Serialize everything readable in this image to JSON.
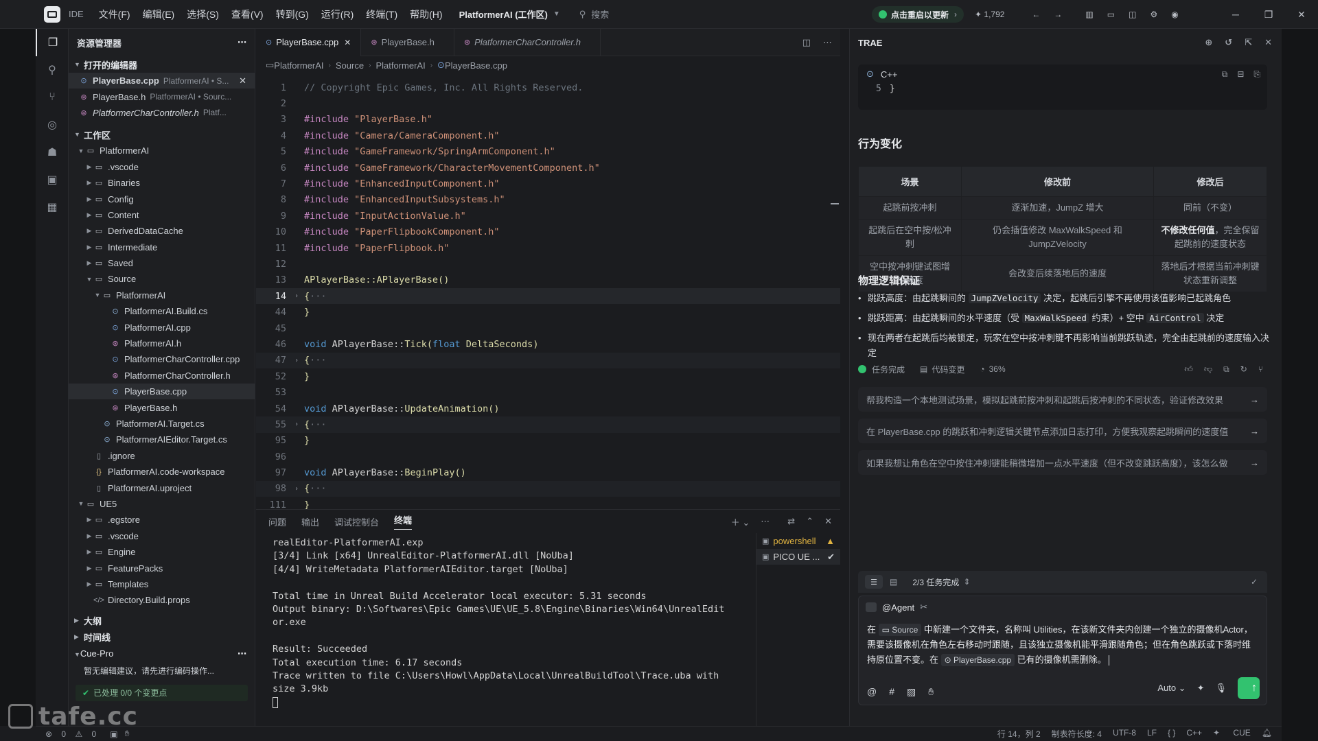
{
  "titlebar": {
    "ide_label": "IDE",
    "menus": [
      "文件(F)",
      "编辑(E)",
      "选择(S)",
      "查看(V)",
      "转到(G)",
      "运行(R)",
      "终端(T)",
      "帮助(H)"
    ],
    "workspace": "PlatformerAI (工作区)",
    "search_placeholder": "搜索",
    "update_label": "点击重启以更新",
    "count": "1,792"
  },
  "sidebar": {
    "title": "资源管理器",
    "open_editors_label": "打开的编辑器",
    "open_editors": [
      {
        "name": "PlayerBase.cpp",
        "path": "PlatformerAI • S...",
        "icon": "cpp-file-icon"
      },
      {
        "name": "PlayerBase.h",
        "path": "PlatformerAI • Sourc...",
        "icon": "h-file-icon"
      },
      {
        "name": "PlatformerCharController.h",
        "path": "Platf...",
        "icon": "h-file-icon"
      }
    ],
    "workspace_label": "工作区",
    "tree": [
      {
        "depth": 1,
        "type": "folder",
        "open": true,
        "name": "PlatformerAI"
      },
      {
        "depth": 2,
        "type": "folder",
        "open": false,
        "name": ".vscode"
      },
      {
        "depth": 2,
        "type": "folder",
        "open": false,
        "name": "Binaries"
      },
      {
        "depth": 2,
        "type": "folder",
        "open": false,
        "name": "Config"
      },
      {
        "depth": 2,
        "type": "folder",
        "open": false,
        "name": "Content"
      },
      {
        "depth": 2,
        "type": "folder",
        "open": false,
        "name": "DerivedDataCache"
      },
      {
        "depth": 2,
        "type": "folder",
        "open": false,
        "name": "Intermediate"
      },
      {
        "depth": 2,
        "type": "folder",
        "open": false,
        "name": "Saved"
      },
      {
        "depth": 2,
        "type": "folder",
        "open": true,
        "name": "Source"
      },
      {
        "depth": 3,
        "type": "folder",
        "open": true,
        "name": "PlatformerAI"
      },
      {
        "depth": 4,
        "type": "cs",
        "name": "PlatformerAI.Build.cs"
      },
      {
        "depth": 4,
        "type": "cpp",
        "name": "PlatformerAI.cpp"
      },
      {
        "depth": 4,
        "type": "h",
        "name": "PlatformerAI.h"
      },
      {
        "depth": 4,
        "type": "cpp",
        "name": "PlatformerCharController.cpp"
      },
      {
        "depth": 4,
        "type": "h",
        "name": "PlatformerCharController.h"
      },
      {
        "depth": 4,
        "type": "cpp",
        "name": "PlayerBase.cpp",
        "selected": true
      },
      {
        "depth": 4,
        "type": "h",
        "name": "PlayerBase.h"
      },
      {
        "depth": 3,
        "type": "cs",
        "name": "PlatformerAI.Target.cs"
      },
      {
        "depth": 3,
        "type": "cs",
        "name": "PlatformerAIEditor.Target.cs"
      },
      {
        "depth": 2,
        "type": "file",
        "name": ".ignore"
      },
      {
        "depth": 2,
        "type": "json",
        "name": "PlatformerAI.code-workspace"
      },
      {
        "depth": 2,
        "type": "file",
        "name": "PlatformerAI.uproject"
      },
      {
        "depth": 1,
        "type": "folder",
        "open": true,
        "name": "UE5"
      },
      {
        "depth": 2,
        "type": "folder",
        "open": false,
        "name": ".egstore"
      },
      {
        "depth": 2,
        "type": "folder",
        "open": false,
        "name": ".vscode"
      },
      {
        "depth": 2,
        "type": "folder",
        "open": false,
        "name": "Engine"
      },
      {
        "depth": 2,
        "type": "folder",
        "open": false,
        "name": "FeaturePacks"
      },
      {
        "depth": 2,
        "type": "folder",
        "open": false,
        "name": "Templates"
      },
      {
        "depth": 2,
        "type": "xml",
        "name": "Directory.Build.props"
      }
    ],
    "outline_label": "大纲",
    "timeline_label": "时间线",
    "cue_label": "Cue-Pro",
    "cue_text": "暂无编辑建议，请先进行编码操作...",
    "cue_status": "已处理 0/0 个变更点"
  },
  "editor": {
    "tabs": [
      {
        "name": "PlayerBase.cpp",
        "icon": "cpp-file-icon",
        "active": true
      },
      {
        "name": "PlayerBase.h",
        "icon": "h-file-icon",
        "active": false
      },
      {
        "name": "PlatformerCharController.h",
        "icon": "h-file-icon",
        "active": false,
        "italic": true
      }
    ],
    "breadcrumb": [
      "PlatformerAI",
      "Source",
      "PlatformerAI",
      "PlayerBase.cpp"
    ],
    "lines": [
      {
        "n": "1",
        "kind": "comment",
        "text": "// Copyright Epic Games, Inc. All Rights Reserved."
      },
      {
        "n": "2",
        "kind": "blank",
        "text": ""
      },
      {
        "n": "3",
        "kind": "include",
        "text": "\"PlayerBase.h\""
      },
      {
        "n": "4",
        "kind": "include",
        "text": "\"Camera/CameraComponent.h\""
      },
      {
        "n": "5",
        "kind": "include",
        "text": "\"GameFramework/SpringArmComponent.h\""
      },
      {
        "n": "6",
        "kind": "include",
        "text": "\"GameFramework/CharacterMovementComponent.h\""
      },
      {
        "n": "7",
        "kind": "include",
        "text": "\"EnhancedInputComponent.h\""
      },
      {
        "n": "8",
        "kind": "include",
        "text": "\"EnhancedInputSubsystems.h\""
      },
      {
        "n": "9",
        "kind": "include",
        "text": "\"InputActionValue.h\""
      },
      {
        "n": "10",
        "kind": "include",
        "text": "\"PaperFlipbookComponent.h\""
      },
      {
        "n": "11",
        "kind": "include",
        "text": "\"PaperFlipbook.h\""
      },
      {
        "n": "12",
        "kind": "blank",
        "text": ""
      },
      {
        "n": "13",
        "kind": "ctor",
        "text": "APlayerBase::APlayerBase()"
      },
      {
        "n": "14",
        "kind": "fold",
        "text": "{",
        "highlight": true
      },
      {
        "n": "44",
        "kind": "close",
        "text": "}"
      },
      {
        "n": "45",
        "kind": "blank",
        "text": ""
      },
      {
        "n": "46",
        "kind": "method",
        "ret": "void",
        "cls": "APlayerBase",
        "fn": "Tick",
        "args": "float DeltaSeconds"
      },
      {
        "n": "47",
        "kind": "fold",
        "text": "{"
      },
      {
        "n": "52",
        "kind": "close",
        "text": "}"
      },
      {
        "n": "53",
        "kind": "blank",
        "text": ""
      },
      {
        "n": "54",
        "kind": "method",
        "ret": "void",
        "cls": "APlayerBase",
        "fn": "UpdateAnimation",
        "args": ""
      },
      {
        "n": "55",
        "kind": "fold",
        "text": "{"
      },
      {
        "n": "95",
        "kind": "close",
        "text": "}"
      },
      {
        "n": "96",
        "kind": "blank",
        "text": ""
      },
      {
        "n": "97",
        "kind": "method",
        "ret": "void",
        "cls": "APlayerBase",
        "fn": "BeginPlay",
        "args": ""
      },
      {
        "n": "98",
        "kind": "fold",
        "text": "{"
      },
      {
        "n": "111",
        "kind": "close",
        "text": "}"
      }
    ]
  },
  "panel": {
    "tabs": [
      "问题",
      "输出",
      "调试控制台",
      "终端"
    ],
    "active_tab": "终端",
    "terminal_lines": [
      "realEditor-PlatformerAI.exp",
      "[3/4] Link [x64] UnrealEditor-PlatformerAI.dll [NoUba]",
      "[4/4] WriteMetadata PlatformerAIEditor.target [NoUba]",
      "",
      "Total time in Unreal Build Accelerator local executor: 5.31 seconds",
      "Output binary: D:\\Softwares\\Epic Games\\UE\\UE_5.8\\Engine\\Binaries\\Win64\\UnrealEdit",
      "or.exe",
      "",
      "Result: Succeeded",
      "Total execution time: 6.17 seconds",
      "Trace written to file C:\\Users\\Howl\\AppData\\Local\\UnrealBuildTool\\Trace.uba with",
      "size 3.9kb"
    ],
    "terminals": [
      {
        "name": "powershell",
        "status": "warn"
      },
      {
        "name": "PICO UE ...",
        "status": "ok"
      }
    ]
  },
  "ai": {
    "title": "TRAE",
    "code_lang": "C++",
    "code_line_no": "5",
    "code_line_text": "}",
    "behavior_title": "行为变化",
    "table_headers": [
      "场景",
      "修改前",
      "修改后"
    ],
    "table_rows": [
      [
        "起跳前按冲刺",
        "逐渐加速，JumpZ 增大",
        "同前（不变）"
      ],
      [
        "起跳后在空中按/松冲刺",
        "仍会插值修改 MaxWalkSpeed 和 JumpZVelocity",
        "不修改任何值，完全保留起跳前的速度状态"
      ],
      [
        "空中按冲刺键试图增加速度",
        "会改变后续落地后的速度",
        "落地后才根据当前冲刺键状态重新调整"
      ]
    ],
    "row2_bold": "不修改任何值",
    "row2_rest": "，完全保留起跳前的速度状态",
    "physics_title": "物理逻辑保证",
    "bullets": [
      {
        "pre": "跳跃高度：由起跳瞬间的 ",
        "code": "JumpZVelocity",
        "post": " 决定，起跳后引擎不再使用该值影响已起跳角色",
        "code2": "",
        "post2": ""
      },
      {
        "pre": "跳跃距离：由起跳瞬间的水平速度（受 ",
        "code": "MaxWalkSpeed",
        "post": " 约束）+ 空中 ",
        "code2": "AirControl",
        "post2": " 决定"
      },
      {
        "pre": "现在两者在起跳后均被锁定，玩家在空中按冲刺键不再影响当前跳跃轨迹，完全由起跳前的速度输入决定",
        "code": "",
        "post": "",
        "code2": "",
        "post2": ""
      }
    ],
    "status_done": "任务完成",
    "status_changes": "代码变更",
    "status_progress": "36%",
    "suggestions": [
      "帮我构造一个本地测试场景，模拟起跳前按冲刺和起跳后按冲刺的不同状态，验证修改效果",
      "在 PlayerBase.cpp 的跳跃和冲刺逻辑关键节点添加日志打印，方便我观察起跳瞬间的速度值",
      "如果我想让角色在空中按住冲刺键能稍微增加一点水平速度（但不改变跳跃高度），该怎么做"
    ],
    "tasks_label": "2/3 任务完成",
    "agent_label": "@Agent",
    "prompt_pre": "在 ",
    "prompt_chip1": "Source",
    "prompt_mid": " 中新建一个文件夹，名称叫 Utilities，在该新文件夹内创建一个独立的摄像机Actor，需要该摄像机在角色左右移动时跟随，且该独立摄像机能平滑跟随角色；但在角色跳跃或下落时维持原位置不变。在 ",
    "prompt_chip2": "PlayerBase.cpp",
    "prompt_post": " 已有的摄像机需删除。",
    "mode": "Auto"
  },
  "statusbar": {
    "errors": "0",
    "warnings": "0",
    "position": "行 14，列 2",
    "tab_size": "制表符长度: 4",
    "encoding": "UTF-8",
    "eol": "LF",
    "lang": "C++",
    "cue": "CUE"
  },
  "watermark": "tafe.cc"
}
